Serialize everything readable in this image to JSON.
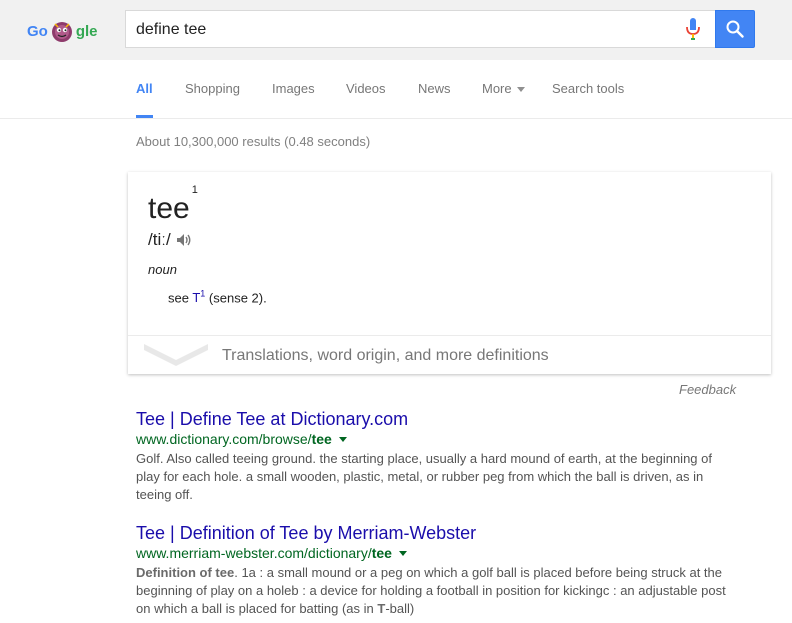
{
  "search": {
    "query": "define tee",
    "logo_letters": [
      "Go",
      "gle"
    ]
  },
  "tabs": [
    {
      "label": "All",
      "active": true
    },
    {
      "label": "Shopping"
    },
    {
      "label": "Images"
    },
    {
      "label": "Videos"
    },
    {
      "label": "News"
    },
    {
      "label": "More"
    },
    {
      "label": "Search tools"
    }
  ],
  "stats": "About 10,300,000 results (0.48 seconds)",
  "dictionary": {
    "word": "tee",
    "superscript": "1",
    "phonetic": "/tiː/",
    "part_of_speech": "noun",
    "definition_prefix": "see ",
    "definition_link": "T",
    "definition_link_sup": "1",
    "definition_suffix": " (sense 2).",
    "more_label": "Translations, word origin, and more definitions"
  },
  "feedback": "Feedback",
  "results": [
    {
      "title": "Tee | Define Tee at Dictionary.com",
      "url_prefix": "www.dictionary.com/browse/",
      "url_bold": "tee",
      "snippet": "Golf. Also called teeing ground. the starting place, usually a hard mound of earth, at the beginning of play for each hole. a small wooden, plastic, metal, or rubber peg from which the ball is driven, as in teeing off."
    },
    {
      "title": "Tee | Definition of Tee by Merriam-Webster",
      "url_prefix": "www.merriam-webster.com/dictionary/",
      "url_bold": "tee",
      "snippet_bold1": "Definition of tee",
      "snippet_part1": ". 1a : a small mound or a peg on which a golf ball is placed before being struck at the beginning of play on a holeb : a device for holding a football in position for kickingc : an adjustable post on which a ball is placed for batting (as in ",
      "snippet_bold2": "T",
      "snippet_part2": "-ball)"
    }
  ],
  "colors": {
    "brand_blue": "#4285f4",
    "link": "#1a0dab",
    "url_green": "#006621"
  },
  "icons": [
    "doodle-icon",
    "microphone-icon",
    "search-icon",
    "speaker-icon",
    "chevron-down-icon",
    "caret-down-icon"
  ]
}
